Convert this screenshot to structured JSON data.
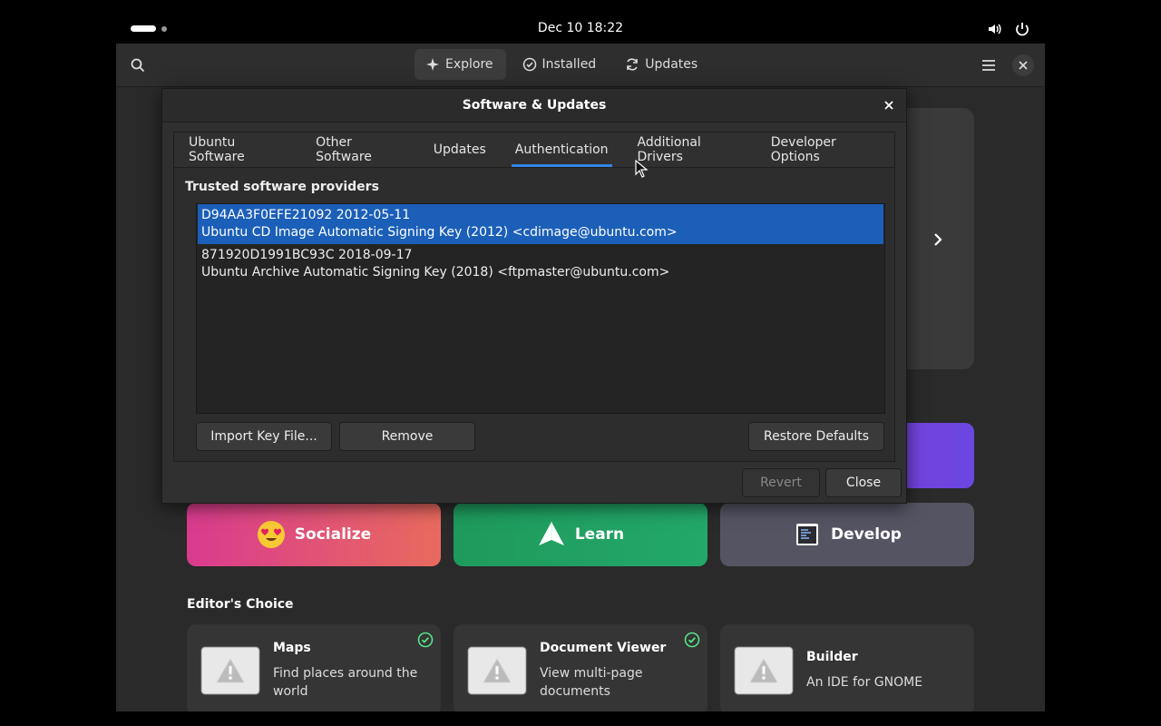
{
  "top_bar": {
    "clock": "Dec 10  18:22"
  },
  "app_header": {
    "tabs": [
      {
        "label": "Explore",
        "icon": "sparkle-icon",
        "active": true
      },
      {
        "label": "Installed",
        "icon": "check-circle-icon",
        "active": false
      },
      {
        "label": "Updates",
        "icon": "refresh-icon",
        "active": false
      }
    ]
  },
  "categories": [
    {
      "label": "Socialize",
      "icon": "heart-eyes-emoji-icon"
    },
    {
      "label": "Learn",
      "icon": "paper-plane-icon"
    },
    {
      "label": "Develop",
      "icon": "code-editor-icon"
    }
  ],
  "editors_choice": {
    "title": "Editor's Choice",
    "apps": [
      {
        "name": "Maps",
        "description": "Find places around the world",
        "installed": true
      },
      {
        "name": "Document Viewer",
        "description": "View multi-page documents",
        "installed": true
      },
      {
        "name": "Builder",
        "description": "An IDE for GNOME",
        "installed": false
      }
    ]
  },
  "dialog": {
    "title": "Software & Updates",
    "tabs": [
      {
        "label": "Ubuntu Software",
        "active": false
      },
      {
        "label": "Other Software",
        "active": false
      },
      {
        "label": "Updates",
        "active": false
      },
      {
        "label": "Authentication",
        "active": true
      },
      {
        "label": "Additional Drivers",
        "active": false
      },
      {
        "label": "Developer Options",
        "active": false
      }
    ],
    "section_label": "Trusted software providers",
    "keys": [
      {
        "id_line": "D94AA3F0EFE21092 2012-05-11",
        "name_line": "Ubuntu CD Image Automatic Signing Key (2012) <cdimage@ubuntu.com>",
        "selected": true
      },
      {
        "id_line": "871920D1991BC93C 2018-09-17",
        "name_line": "Ubuntu Archive Automatic Signing Key (2018) <ftpmaster@ubuntu.com>",
        "selected": false
      }
    ],
    "buttons": {
      "import": "Import Key File...",
      "remove": "Remove",
      "restore": "Restore Defaults",
      "revert": "Revert",
      "close": "Close"
    }
  },
  "colors": {
    "accent": "#3584e4",
    "selection": "#1b5fb8"
  }
}
